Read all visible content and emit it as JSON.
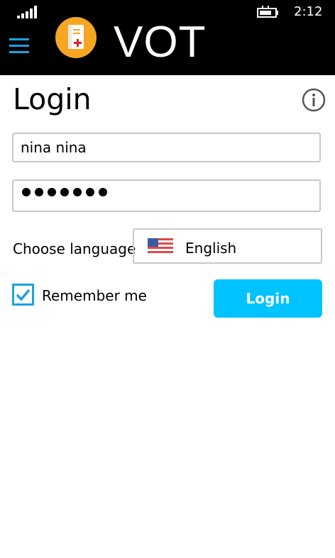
{
  "status_bar": {
    "time": "2:12"
  },
  "app_bar": {
    "title": "VOT",
    "brand_color": "#1ba1e2",
    "logo_color": "#f5a623"
  },
  "page": {
    "title": "Login"
  },
  "form": {
    "username_value": "nina nina",
    "password_masked_length": 7,
    "language_label": "Choose language",
    "language_selected": "English",
    "remember_me_label": "Remember me",
    "remember_me_checked": true,
    "login_button_label": "Login",
    "login_button_color": "#00c3ff"
  },
  "icons": [
    "signal-icon",
    "battery-icon",
    "menu-icon",
    "app-logo",
    "info-icon",
    "us-flag-icon",
    "checkmark-icon"
  ]
}
